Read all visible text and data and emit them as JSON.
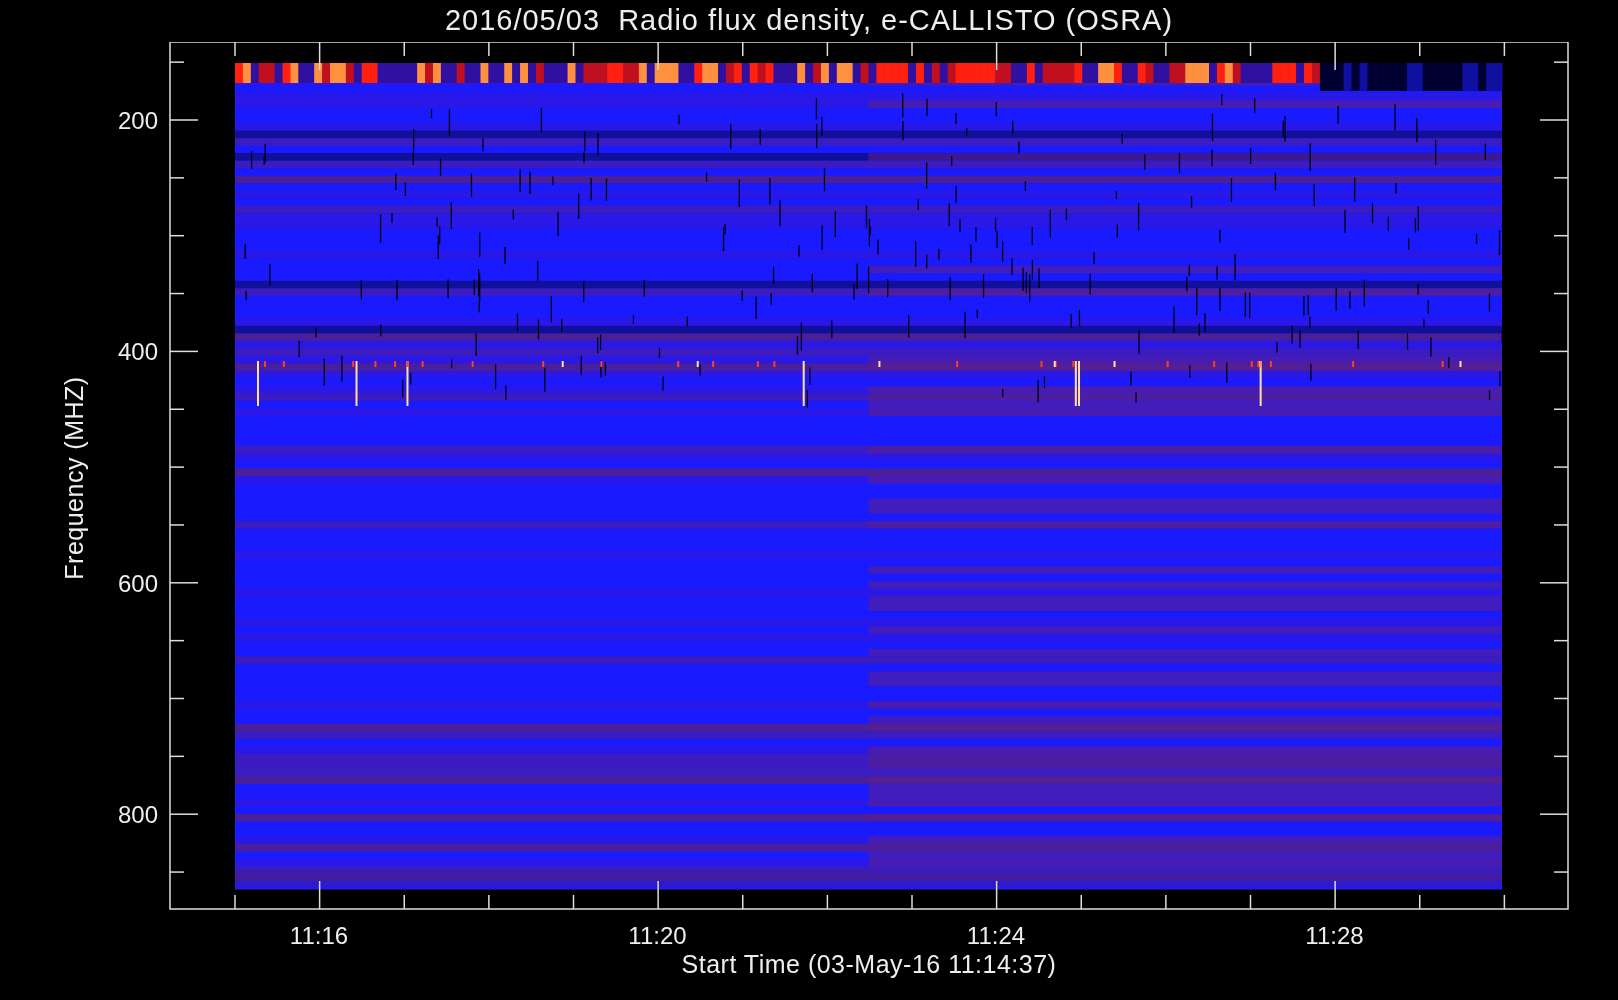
{
  "title": "2016/05/03  Radio flux density, e-CALLISTO (OSRA)",
  "plot": {
    "ylabel": "Frequency (MHZ)",
    "xlabel": "Start Time (03-May-16 11:14:37)",
    "yticks": [
      "200",
      "400",
      "600",
      "800"
    ],
    "xticks": [
      "11:16",
      "11:20",
      "11:24",
      "11:28"
    ]
  }
}
